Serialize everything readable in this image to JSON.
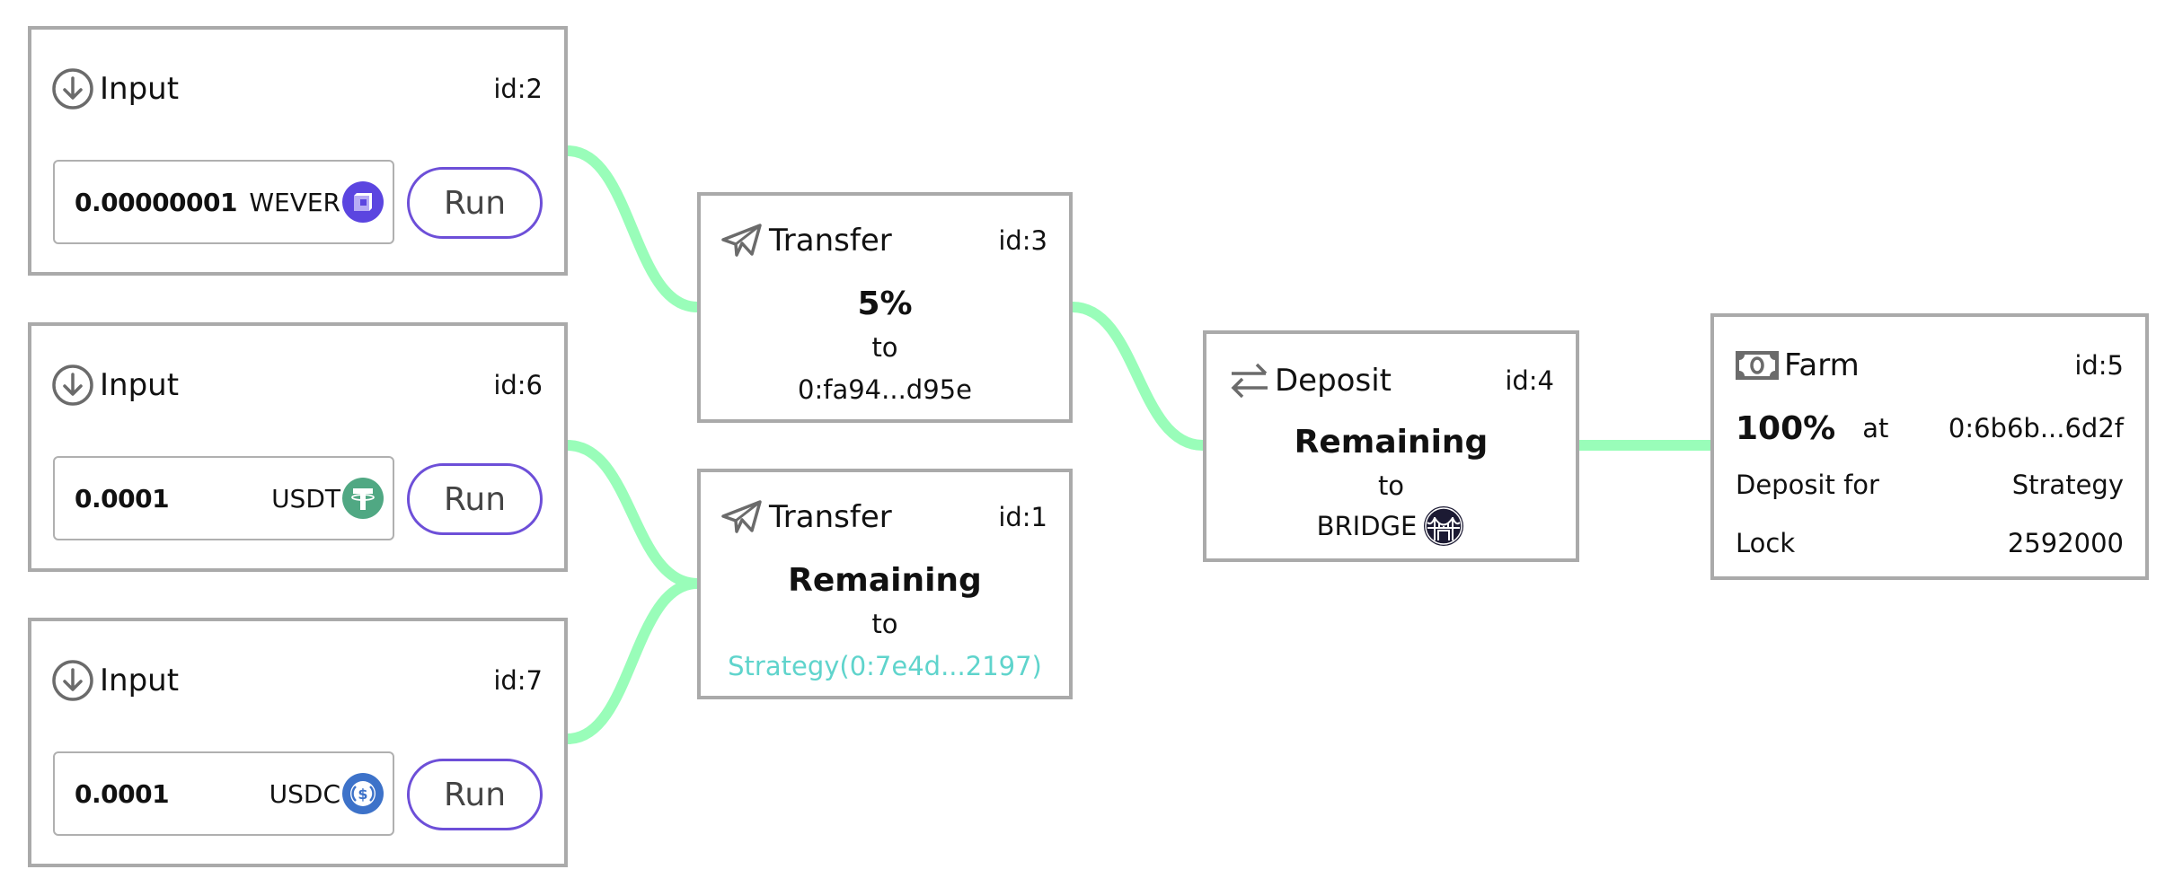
{
  "colors": {
    "edge": "#99fdb9",
    "node_border": "#aaaaaa",
    "run_border": "#6d4fd8",
    "strategy_link": "#5fd4cc",
    "icon_gray": "#6b6b6b",
    "wever": "#5b45e0",
    "usdt": "#50a883",
    "usdc": "#3d72c9",
    "bridge": "#1c1a33"
  },
  "nodes": {
    "input_2": {
      "title": "Input",
      "id_label": "id:2",
      "icon": "arrow-down-circle-icon",
      "amount": "0.00000001",
      "token": "WEVER",
      "token_icon": "wever-icon",
      "run_label": "Run"
    },
    "input_6": {
      "title": "Input",
      "id_label": "id:6",
      "icon": "arrow-down-circle-icon",
      "amount": "0.0001",
      "token": "USDT",
      "token_icon": "usdt-icon",
      "run_label": "Run"
    },
    "input_7": {
      "title": "Input",
      "id_label": "id:7",
      "icon": "arrow-down-circle-icon",
      "amount": "0.0001",
      "token": "USDC",
      "token_icon": "usdc-icon",
      "run_label": "Run"
    },
    "transfer_3": {
      "title": "Transfer",
      "id_label": "id:3",
      "icon": "paper-plane-icon",
      "amount": "5%",
      "to_label": "to",
      "recipient": "0:fa94...d95e"
    },
    "transfer_1": {
      "title": "Transfer",
      "id_label": "id:1",
      "icon": "paper-plane-icon",
      "amount": "Remaining",
      "to_label": "to",
      "recipient": "Strategy(0:7e4d...2197)"
    },
    "deposit_4": {
      "title": "Deposit",
      "id_label": "id:4",
      "icon": "swap-arrows-icon",
      "amount": "Remaining",
      "to_label": "to",
      "recipient": "BRIDGE",
      "recipient_icon": "bridge-icon"
    },
    "farm_5": {
      "title": "Farm",
      "id_label": "id:5",
      "icon": "banknote-icon",
      "percent": "100%",
      "at_label": "at",
      "address": "0:6b6b...6d2f",
      "deposit_for_label": "Deposit for",
      "deposit_for_value": "Strategy",
      "lock_label": "Lock",
      "lock_value": "2592000"
    }
  },
  "edges": [
    {
      "from": "input_2",
      "to": "transfer_3"
    },
    {
      "from": "input_6",
      "to": "transfer_1"
    },
    {
      "from": "input_7",
      "to": "transfer_1"
    },
    {
      "from": "transfer_3",
      "to": "deposit_4"
    },
    {
      "from": "deposit_4",
      "to": "farm_5"
    }
  ]
}
